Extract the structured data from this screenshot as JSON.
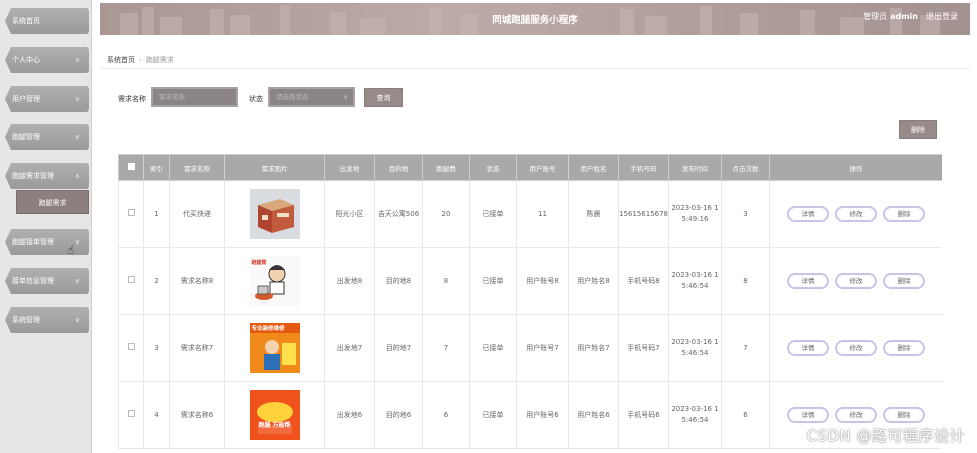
{
  "header": {
    "title": "同城跑腿服务小程序",
    "role": "管理员",
    "username": "admin",
    "logout": "退出登录"
  },
  "sidebar": {
    "items": [
      {
        "label": "系统首页",
        "chev": false
      },
      {
        "label": "个人中心",
        "chev": true
      },
      {
        "label": "用户管理",
        "chev": true
      },
      {
        "label": "跑腿管理",
        "chev": true
      },
      {
        "label": "跑腿需求管理",
        "chev": true
      },
      {
        "label": "跑腿接单管理",
        "chev": true
      },
      {
        "label": "接单信息管理",
        "chev": true
      },
      {
        "label": "系统管理",
        "chev": true
      }
    ],
    "submenu_item": "跑腿需求"
  },
  "breadcrumb": {
    "home": "系统首页",
    "current": "跑腿需求"
  },
  "search": {
    "name_label": "需求名称",
    "name_placeholder": "需求名称",
    "status_label": "状态",
    "status_placeholder": "请选择状态",
    "button": "查询"
  },
  "delete_button": "删除",
  "table": {
    "headers": [
      "索引",
      "需求名称",
      "需求图片",
      "出发地",
      "目的地",
      "跑腿费",
      "状态",
      "用户账号",
      "用户姓名",
      "手机号码",
      "发布时间",
      "点击次数",
      "操作"
    ],
    "rows": [
      {
        "index": "1",
        "name": "代买快递",
        "from": "阳光小区",
        "to": "吉天公寓506",
        "fee": "20",
        "status": "已接单",
        "account": "11",
        "user": "陈晨",
        "phone": "15615615678",
        "time": "2023-03-16 15:49:16",
        "clicks": "3",
        "image": "parcel-box"
      },
      {
        "index": "2",
        "name": "需求名称8",
        "from": "出发地8",
        "to": "目的地8",
        "fee": "8",
        "status": "已接单",
        "account": "用户账号8",
        "user": "用户姓名8",
        "phone": "手机号码8",
        "time": "2023-03-16 15:46:54",
        "clicks": "8",
        "image": "courier-cartoon",
        "image_text": "跑腿帮"
      },
      {
        "index": "3",
        "name": "需求名称7",
        "from": "出发地7",
        "to": "目的地7",
        "fee": "7",
        "status": "已接单",
        "account": "用户账号7",
        "user": "用户姓名7",
        "phone": "手机号码7",
        "time": "2023-03-16 15:46:54",
        "clicks": "7",
        "image": "repair-poster",
        "image_text": "专业装修维修"
      },
      {
        "index": "4",
        "name": "需求名称6",
        "from": "出发地6",
        "to": "目的地6",
        "fee": "6",
        "status": "已接单",
        "account": "用户账号6",
        "user": "用户姓名6",
        "phone": "手机号码6",
        "time": "2023-03-16 15:46:54",
        "clicks": "6",
        "image": "errand-logo",
        "image_text": "跑腿 万能帮"
      }
    ],
    "actions": {
      "detail": "详情",
      "edit": "修改",
      "delete": "删除"
    }
  },
  "watermark": "CSDN @路可程序设计"
}
